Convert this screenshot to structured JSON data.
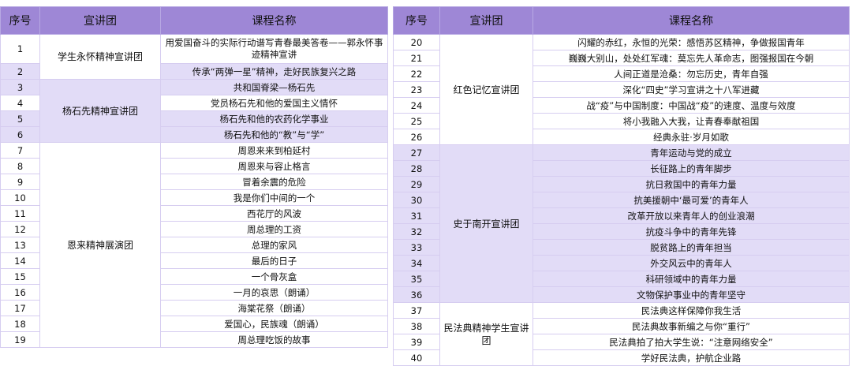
{
  "headers": {
    "num": "序号",
    "team": "宣讲团",
    "course": "课程名称"
  },
  "left": {
    "groups": [
      {
        "team": "学生永怀精神宣讲团",
        "rows": [
          {
            "num": "1",
            "title": "用爱国奋斗的实际行动谱写青春最美答卷——郭永怀事迹精神宣讲"
          },
          {
            "num": "2",
            "title": "传承“两弹一星”精神，走好民族复兴之路"
          }
        ]
      },
      {
        "team": "杨石先精神宣讲团",
        "rows": [
          {
            "num": "3",
            "title": "共和国脊梁—杨石先"
          },
          {
            "num": "4",
            "title": "党员杨石先和他的爱国主义情怀"
          },
          {
            "num": "5",
            "title": "杨石先和他的农药化学事业"
          },
          {
            "num": "6",
            "title": "杨石先和他的“教”与“学”"
          }
        ]
      },
      {
        "team": "恩来精神展演团",
        "rows": [
          {
            "num": "7",
            "title": "周恩来来到柏延村"
          },
          {
            "num": "8",
            "title": "周恩来与容止格言"
          },
          {
            "num": "9",
            "title": "冒着余震的危险"
          },
          {
            "num": "10",
            "title": "我是你们中间的一个"
          },
          {
            "num": "11",
            "title": "西花厅的风波"
          },
          {
            "num": "12",
            "title": "周总理的工资"
          },
          {
            "num": "13",
            "title": "总理的家风"
          },
          {
            "num": "14",
            "title": "最后的日子"
          },
          {
            "num": "15",
            "title": "一个骨灰盒"
          },
          {
            "num": "16",
            "title": "一月的哀思（朗诵）"
          },
          {
            "num": "17",
            "title": "海棠花祭（朗诵）"
          },
          {
            "num": "18",
            "title": "爱国心，民族魂（朗诵）"
          },
          {
            "num": "19",
            "title": "周总理吃饭的故事"
          }
        ]
      }
    ]
  },
  "right": {
    "groups": [
      {
        "team": "红色记忆宣讲团",
        "rows": [
          {
            "num": "20",
            "title": "闪耀的赤红，永恒的光荣：感悟苏区精神，争做报国青年"
          },
          {
            "num": "21",
            "title": "巍巍大别山，处处红军魂：莫忘先人革命志，图强报国在今朝"
          },
          {
            "num": "22",
            "title": "人间正道是沧桑：勿忘历史，青年自强"
          },
          {
            "num": "23",
            "title": "深化“四史”学习宣讲之十八军进藏"
          },
          {
            "num": "24",
            "title": "战“疫”与中国制度：中国战“疫”的速度、温度与效度"
          },
          {
            "num": "25",
            "title": "将小我融入大我，让青春奉献祖国"
          },
          {
            "num": "26",
            "title": "经典永驻·岁月如歌"
          }
        ]
      },
      {
        "team": "史于南开宣讲团",
        "rows": [
          {
            "num": "27",
            "title": "青年运动与党的成立"
          },
          {
            "num": "28",
            "title": "长征路上的青年脚步"
          },
          {
            "num": "29",
            "title": "抗日救国中的青年力量"
          },
          {
            "num": "30",
            "title": "抗美援朝中‘最可爱’的青年人"
          },
          {
            "num": "31",
            "title": "改革开放以来青年人的创业浪潮"
          },
          {
            "num": "32",
            "title": "抗疫斗争中的青年先锋"
          },
          {
            "num": "33",
            "title": "脱贫路上的青年担当"
          },
          {
            "num": "34",
            "title": "外交风云中的青年人"
          },
          {
            "num": "35",
            "title": "科研领域中的青年力量"
          },
          {
            "num": "36",
            "title": "文物保护事业中的青年坚守"
          }
        ]
      },
      {
        "team": "民法典精神学生宣讲团",
        "rows": [
          {
            "num": "37",
            "title": "民法典这样保障你我生活"
          },
          {
            "num": "38",
            "title": "民法典故事新编之与你“重行”"
          },
          {
            "num": "39",
            "title": "民法典拍了拍大学生说：“注意网络安全”"
          },
          {
            "num": "40",
            "title": "学好民法典，护航企业路"
          }
        ]
      }
    ]
  }
}
